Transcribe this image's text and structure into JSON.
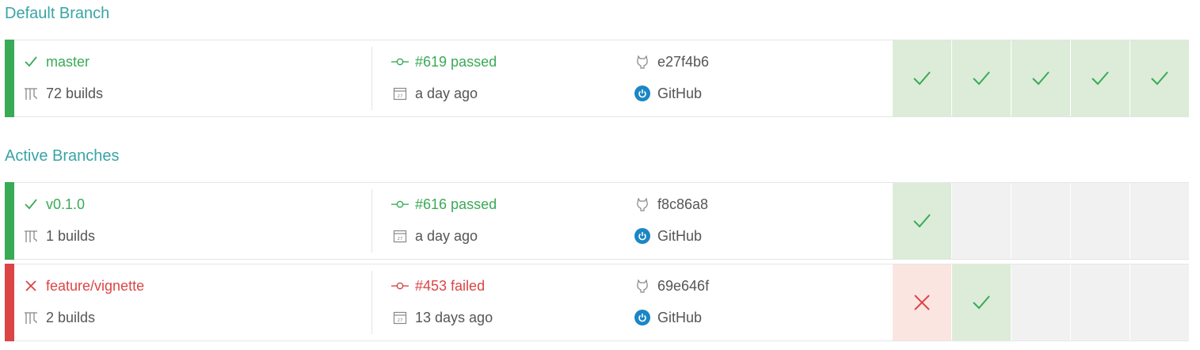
{
  "default_section": {
    "title": "Default Branch"
  },
  "active_section": {
    "title": "Active Branches"
  },
  "colors": {
    "passed": "#39aa56",
    "failed": "#db4545",
    "accent": "#3aa4a6"
  },
  "branches": [
    {
      "status": "passed",
      "name": "master",
      "builds": "72 builds",
      "build": "#619 passed",
      "when": "a day ago",
      "commit": "e27f4b6",
      "source": "GitHub",
      "history": [
        "passed",
        "passed",
        "passed",
        "passed",
        "passed"
      ]
    },
    {
      "status": "passed",
      "name": "v0.1.0",
      "builds": "1 builds",
      "build": "#616 passed",
      "when": "a day ago",
      "commit": "f8c86a8",
      "source": "GitHub",
      "history": [
        "passed",
        "empty",
        "empty",
        "empty",
        "empty"
      ]
    },
    {
      "status": "failed",
      "name": "feature/vignette",
      "builds": "2 builds",
      "build": "#453 failed",
      "when": "13 days ago",
      "commit": "69e646f",
      "source": "GitHub",
      "history": [
        "failed",
        "passed",
        "empty",
        "empty",
        "empty"
      ]
    }
  ]
}
